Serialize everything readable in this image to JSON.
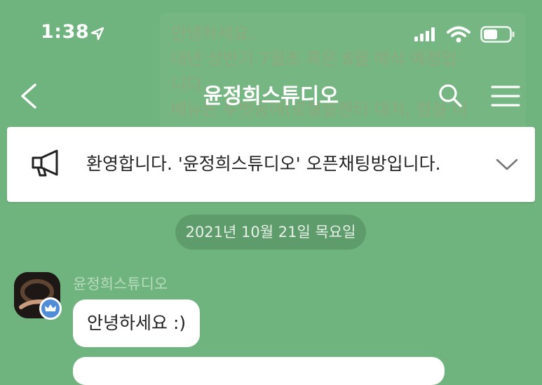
{
  "background_preview": {
    "lines": [
      "안녕하세요.",
      "내년 상반기 7월초 혹은 8월 예식 예정입",
      "니다.",
      "베뉴는 루벗공에(로블랄렌티 대치, 컴실 이"
    ]
  },
  "status_bar": {
    "time": "1:38"
  },
  "header": {
    "title": "윤정희스튜디오"
  },
  "notice": {
    "text": "환영합니다. '윤정희스튜디오' 오픈채팅방입니다."
  },
  "chat": {
    "date": "2021년 10월 21일 목요일",
    "message": {
      "sender": "윤정희스튜디오",
      "text": "안녕하세요 :)"
    }
  },
  "colors": {
    "background": "#6fb37f",
    "date_pill": "#5f9c6c",
    "crown_badge": "#4f8dd8"
  },
  "icons": [
    "location-arrow-icon",
    "signal-icon",
    "wifi-icon",
    "battery-icon",
    "back-chevron-icon",
    "search-icon",
    "menu-icon",
    "megaphone-icon",
    "chevron-down-icon",
    "crown-icon"
  ]
}
